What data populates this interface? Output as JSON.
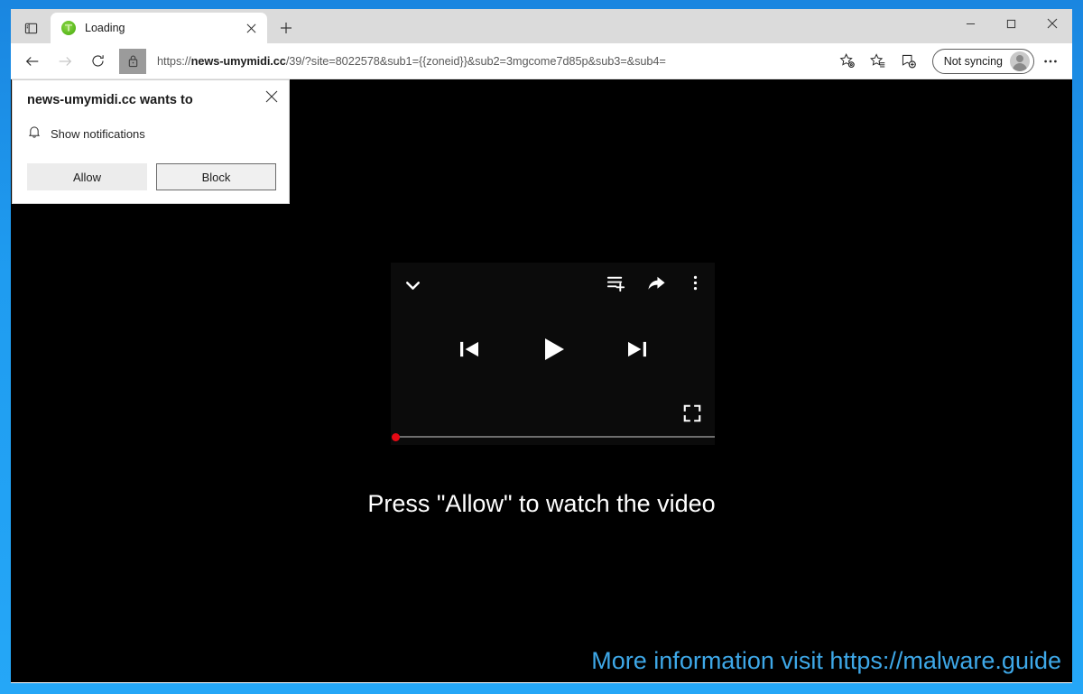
{
  "window": {
    "controls": {
      "minimize": "minimize",
      "maximize": "maximize",
      "close": "close"
    }
  },
  "tabs": {
    "tab_search_tooltip": "Tab actions",
    "items": [
      {
        "title": "Loading",
        "favicon": "green-circle-favicon",
        "close_label": "Close tab"
      }
    ],
    "new_tab_label": "New tab"
  },
  "toolbar": {
    "back_label": "Back",
    "forward_label": "Forward",
    "refresh_label": "Refresh",
    "site_info_label": "View site information",
    "url": "https://news-umymidi.cc/39/?site=8022578&sub1={{zoneid}}&sub2=3mgcome7d85p&sub3=&sub4=",
    "url_host": "news-umymidi.cc",
    "url_prefix": "https://",
    "url_suffix": "/39/?site=8022578&sub1={{zoneid}}&sub2=3mgcome7d85p&sub3=&sub4=",
    "favorite_label": "Add this page to favorites",
    "favorites_label": "Favorites",
    "collections_label": "Collections",
    "profile_label": "Not syncing",
    "settings_label": "Settings and more"
  },
  "permission_popup": {
    "title": "news-umymidi.cc wants to",
    "permission": "Show notifications",
    "permission_icon": "bell-icon",
    "allow_label": "Allow",
    "block_label": "Block",
    "close_label": "Close"
  },
  "player": {
    "collapse_label": "Collapse",
    "add_to_queue_label": "Add to queue",
    "share_label": "Share",
    "more_label": "More options",
    "previous_label": "Previous",
    "play_label": "Play",
    "next_label": "Next",
    "fullscreen_label": "Fullscreen",
    "progress_percent": 0
  },
  "page": {
    "cta_text": "Press \"Allow\" to watch the video",
    "watermark": "More information visit https://malware.guide",
    "background_color": "#000000",
    "watermark_color": "#3ea8e8"
  }
}
